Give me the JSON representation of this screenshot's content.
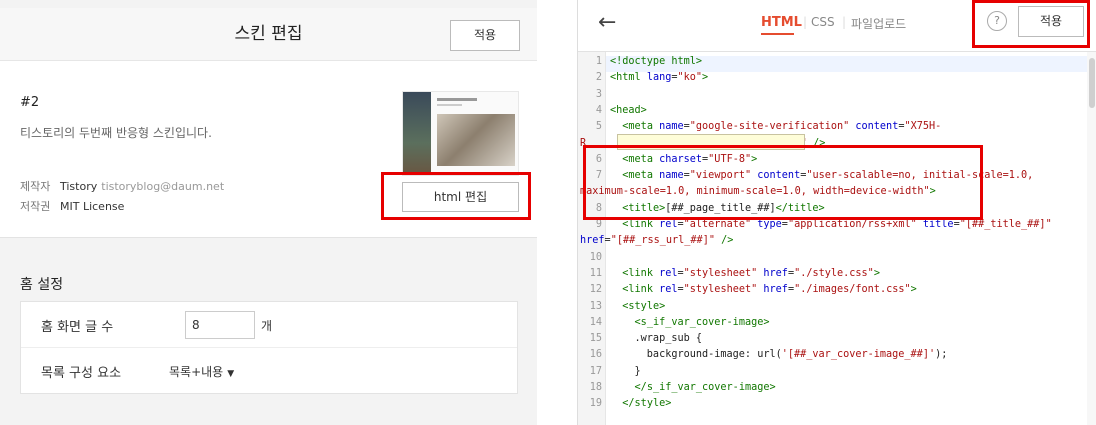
{
  "left": {
    "title": "스킨 편집",
    "apply_label": "적용",
    "skin": {
      "number": "#2",
      "description": "티스토리의 두번째 반응형 스킨입니다.",
      "maker_key": "제작자",
      "maker_name": "Tistory",
      "maker_email": "tistoryblog@daum.net",
      "license_key": "저작권",
      "license_value": "MIT License",
      "html_edit_label": "html 편집"
    },
    "home_settings": {
      "title": "홈 설정",
      "rows": [
        {
          "label": "홈 화면 글 수",
          "value": "8",
          "unit": "개"
        },
        {
          "label": "목록 구성 요소",
          "value": "목록+내용"
        }
      ]
    }
  },
  "right": {
    "tabs": [
      "HTML",
      "CSS",
      "파일업로드"
    ],
    "active_tab": "HTML",
    "apply_label": "적용",
    "help_label": "?",
    "back_icon": "arrow-left-icon",
    "highlight_color": "#e60000",
    "line_numbers": [
      "1",
      "2",
      "3",
      "4",
      "5",
      "",
      "6",
      "7",
      "",
      "8",
      "9",
      "",
      "10",
      "11",
      "12",
      "13",
      "14",
      "15",
      "16",
      "17",
      "18",
      "19"
    ]
  }
}
